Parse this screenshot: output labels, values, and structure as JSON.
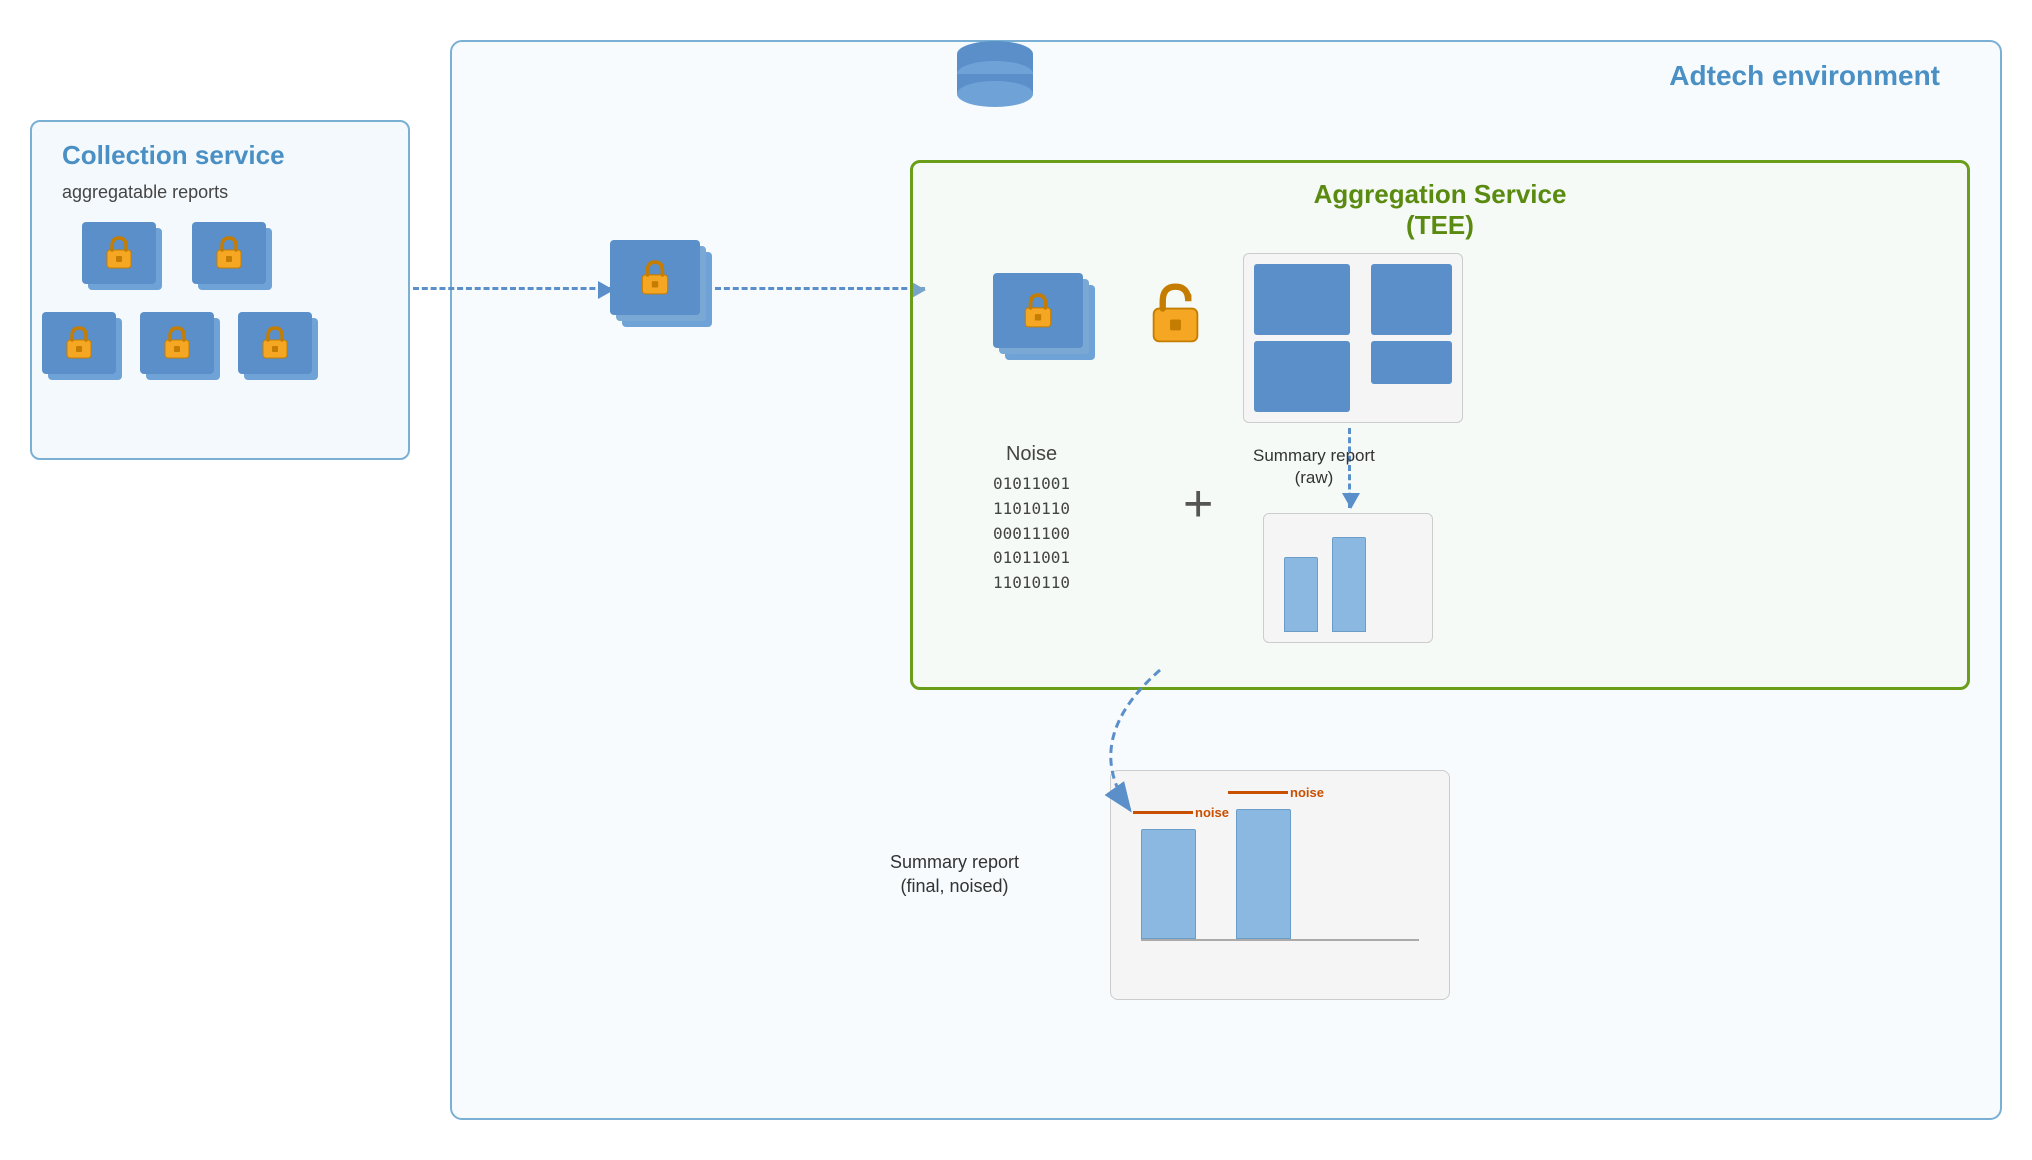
{
  "diagram": {
    "adtech_env_title": "Adtech environment",
    "collection_service": {
      "title": "Collection service",
      "subtitle": "aggregatable reports"
    },
    "aggregation_service": {
      "title": "Aggregation Service",
      "subtitle": "(TEE)"
    },
    "noise_label": "Noise",
    "noise_binary": [
      "01011001",
      "11010110",
      "00011100",
      "01011001",
      "11010110"
    ],
    "plus_symbol": "+",
    "summary_report_raw_label": "Summary report",
    "summary_report_raw_sub": "(raw)",
    "summary_report_final_label": "Summary report",
    "summary_report_final_sub": "(final, noised)",
    "noise_tag_1": "noise",
    "noise_tag_2": "noise",
    "bars_raw": [
      55,
      80
    ],
    "bars_final": [
      65,
      75
    ]
  }
}
